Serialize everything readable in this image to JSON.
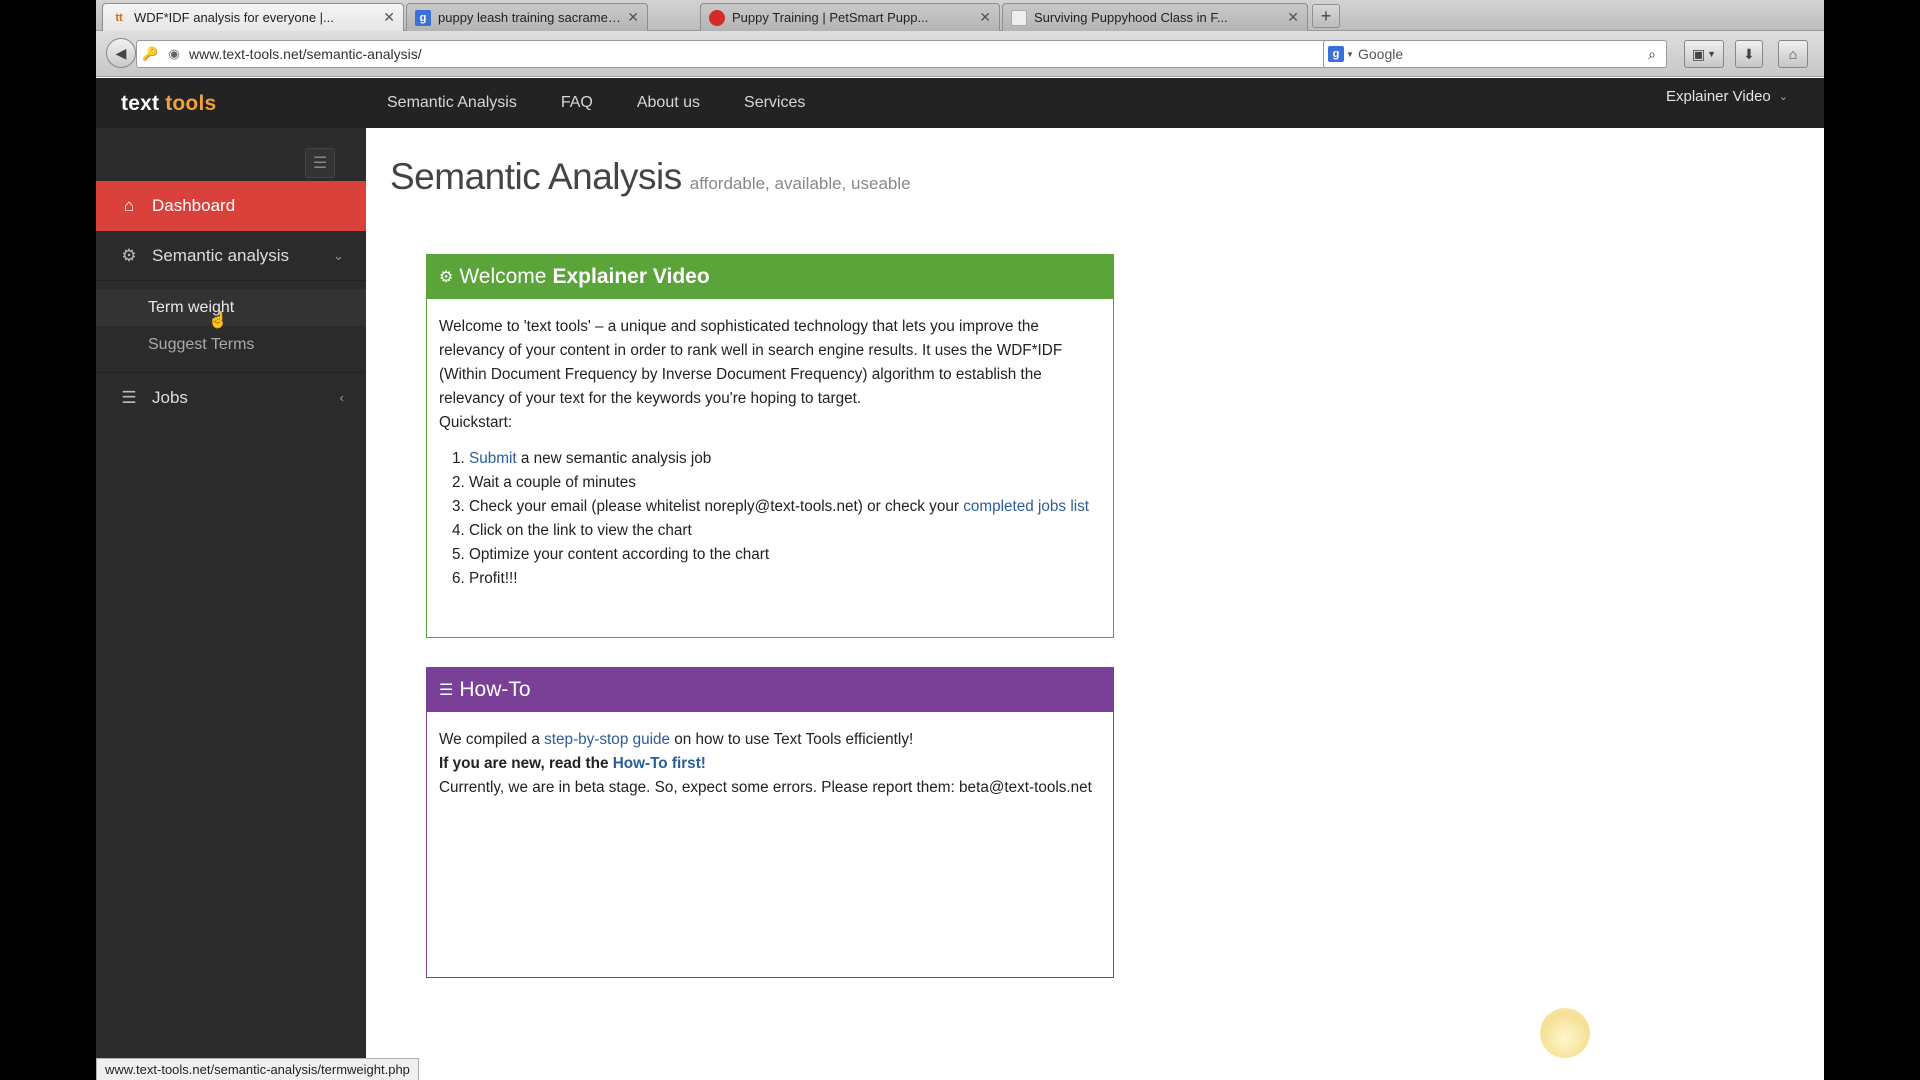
{
  "browser": {
    "tabs": [
      {
        "title": "WDF*IDF analysis for everyone |...",
        "favicon": "tt",
        "active": true
      },
      {
        "title": "puppy leash training sacrament...",
        "favicon": "g"
      },
      {
        "title": "Puppy Training | PetSmart Pupp...",
        "favicon": "petsmart"
      },
      {
        "title": "Surviving Puppyhood Class in F...",
        "favicon": "blank"
      }
    ],
    "url": "www.text-tools.net/semantic-analysis/",
    "search_placeholder": "Google",
    "search_engine_icon": "g"
  },
  "site": {
    "logo_text": "text",
    "logo_accent": "tools",
    "nav": [
      "Semantic Analysis",
      "FAQ",
      "About us",
      "Services"
    ],
    "user_menu": "Explainer Video"
  },
  "sidebar": {
    "items": [
      {
        "label": "Dashboard",
        "icon": "home-icon"
      },
      {
        "label": "Semantic analysis",
        "icon": "cogs-icon"
      },
      {
        "label": "Jobs",
        "icon": "list-icon"
      }
    ],
    "subitems": [
      "Term weight",
      "Suggest Terms"
    ]
  },
  "page": {
    "title": "Semantic Analysis",
    "subtitle": "affordable, available, useable"
  },
  "welcome": {
    "title_prefix": "Welcome",
    "title_bold": "Explainer Video",
    "intro": "Welcome to 'text tools' – a unique and sophisticated technology that lets you improve the relevancy of your content in order to rank well in search engine results. It uses the WDF*IDF (Within Document Frequency by Inverse Document Frequency) algorithm to establish the relevancy of your text for the keywords you're hoping to target.",
    "quickstart": "Quickstart:",
    "step1_link": "Submit",
    "step1_rest": " a new semantic analysis job",
    "step2": "Wait a couple of minutes",
    "step3_text": "Check your email (please whitelist noreply@text-tools.net) or check your ",
    "step3_link": "completed jobs list",
    "step4": "Click on the link to view the chart",
    "step5": "Optimize your content according to the chart",
    "step6": "Profit!!!"
  },
  "howto": {
    "title": "How-To",
    "line1_pre": "We compiled a ",
    "line1_link": "step-by-stop guide",
    "line1_post": " on how to use Text Tools efficiently!",
    "line2_pre": "If you are new, read the ",
    "line2_link": "How-To first!",
    "line3": "Currently, we are in beta stage. So, expect some errors. Please report them: beta@text-tools.net"
  },
  "status_bar": "www.text-tools.net/semantic-analysis/termweight.php",
  "colors": {
    "dashboard_active": "#d9413a",
    "welcome_panel": "#5aa43a",
    "howto_panel": "#7a3f97",
    "link": "#2a5d9a",
    "logo_accent": "#f0a23a"
  }
}
